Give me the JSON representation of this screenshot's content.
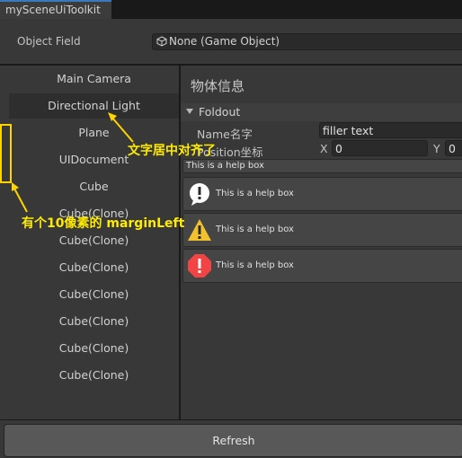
{
  "window": {
    "tab_title": "mySceneUiToolkit"
  },
  "object_field": {
    "label": "Object Field",
    "value": "None (Game Object)",
    "icon": "game-object-cube-icon"
  },
  "scene_list": {
    "items": [
      {
        "label": "Main Camera",
        "selected": false
      },
      {
        "label": "Directional Light",
        "selected": true
      },
      {
        "label": "Plane",
        "selected": false
      },
      {
        "label": "UIDocument",
        "selected": false
      },
      {
        "label": "Cube",
        "selected": false
      },
      {
        "label": "Cube(Clone)",
        "selected": false
      },
      {
        "label": "Cube(Clone)",
        "selected": false
      },
      {
        "label": "Cube(Clone)",
        "selected": false
      },
      {
        "label": "Cube(Clone)",
        "selected": false
      },
      {
        "label": "Cube(Clone)",
        "selected": false
      },
      {
        "label": "Cube(Clone)",
        "selected": false
      },
      {
        "label": "Cube(Clone)",
        "selected": false
      }
    ]
  },
  "info_panel": {
    "title": "物体信息",
    "foldout": {
      "label": "Foldout",
      "expanded": true
    },
    "name_field": {
      "label": "Name名字",
      "value": "filler text"
    },
    "position_field": {
      "label": "Position坐标",
      "x_label": "X",
      "x_value": "0",
      "y_label": "Y",
      "y_value": "0"
    },
    "help_plain": "This is a help box",
    "help_boxes": [
      {
        "type": "info",
        "icon": "info-icon",
        "text": "This is a help box",
        "color": "#ffffff"
      },
      {
        "type": "warning",
        "icon": "warning-icon",
        "text": "This is a help box",
        "color": "#f2c12e"
      },
      {
        "type": "error",
        "icon": "error-icon",
        "text": "This is a help box",
        "color": "#f24444"
      }
    ]
  },
  "footer": {
    "refresh_label": "Refresh"
  },
  "annotations": {
    "centered_text_note": "文字居中对齐了",
    "margin_note": "有个10像素的 marginLeft",
    "color": "#ffea00"
  }
}
